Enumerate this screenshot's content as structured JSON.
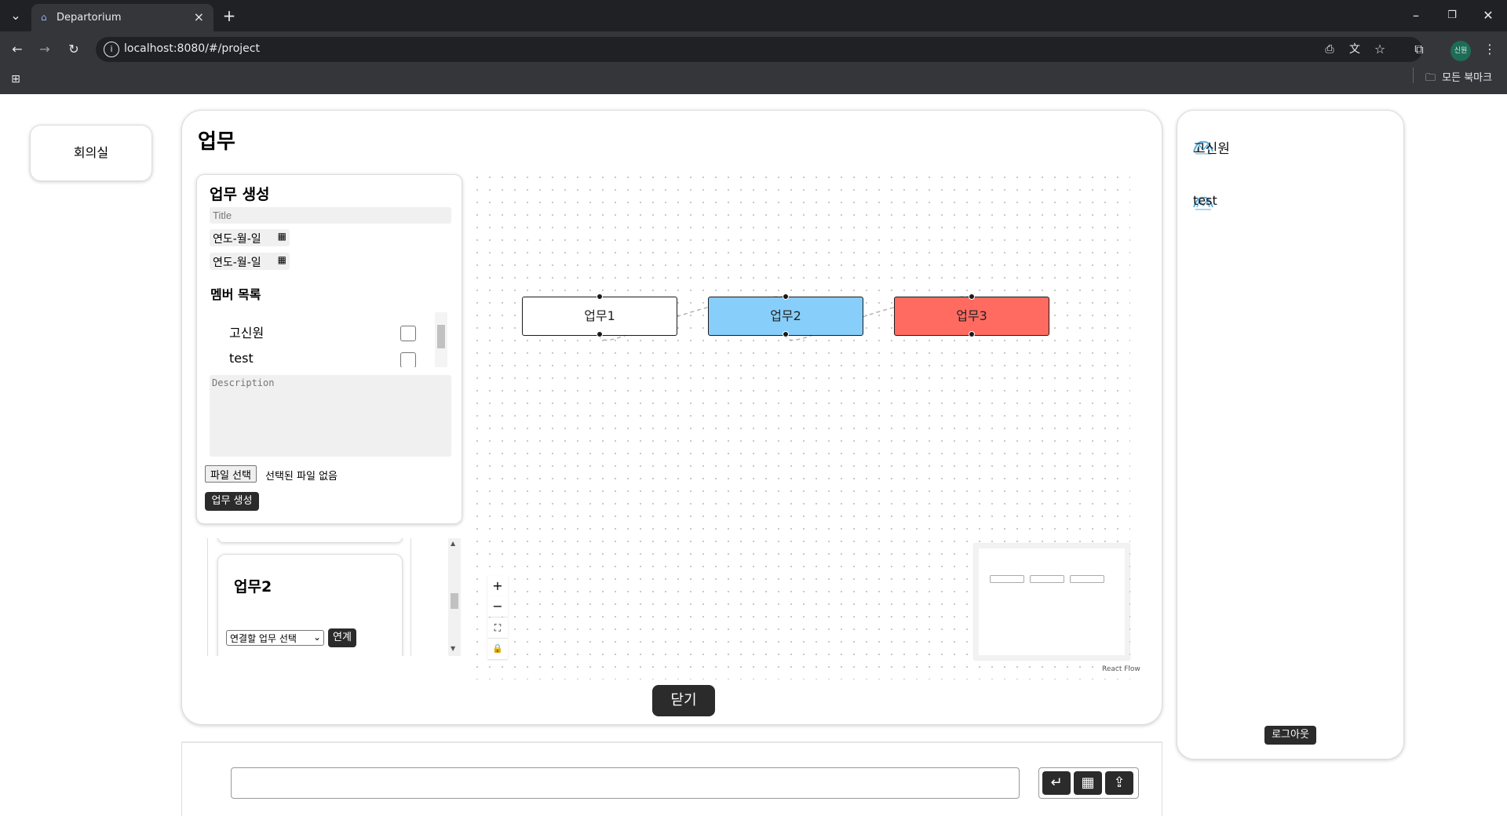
{
  "browser": {
    "tab_title": "Departorium",
    "url": "localhost:8080/#/project",
    "profile_label": "신원",
    "bookmarks_label": "모든 북마크"
  },
  "sidebar": {
    "room_button": "회의실"
  },
  "work": {
    "title": "업무",
    "create_form": {
      "heading": "업무 생성",
      "title_placeholder": "Title",
      "start_date": "연도-월-일",
      "end_date": "연도-월-일",
      "members_heading": "멤버 목록",
      "members": [
        {
          "name": "고신원",
          "checked": false
        },
        {
          "name": "test",
          "checked": false
        }
      ],
      "description_placeholder": "Description",
      "file_button": "파일 선택",
      "file_status": "선택된 파일 없음",
      "submit_button": "업무 생성"
    },
    "task_card": {
      "name": "업무2",
      "link_select": "연결할 업무 선택",
      "link_button": "연계"
    },
    "flow": {
      "nodes": [
        {
          "label": "업무1",
          "color": "#ffffff"
        },
        {
          "label": "업무2",
          "color": "#87cefa"
        },
        {
          "label": "업무3",
          "color": "#ff6b61"
        }
      ],
      "attribution": "React Flow"
    },
    "close_button": "닫기"
  },
  "members_panel": {
    "members": [
      "고신원",
      "test"
    ],
    "logout_button": "로그아웃"
  },
  "chat": {
    "input_value": ""
  }
}
